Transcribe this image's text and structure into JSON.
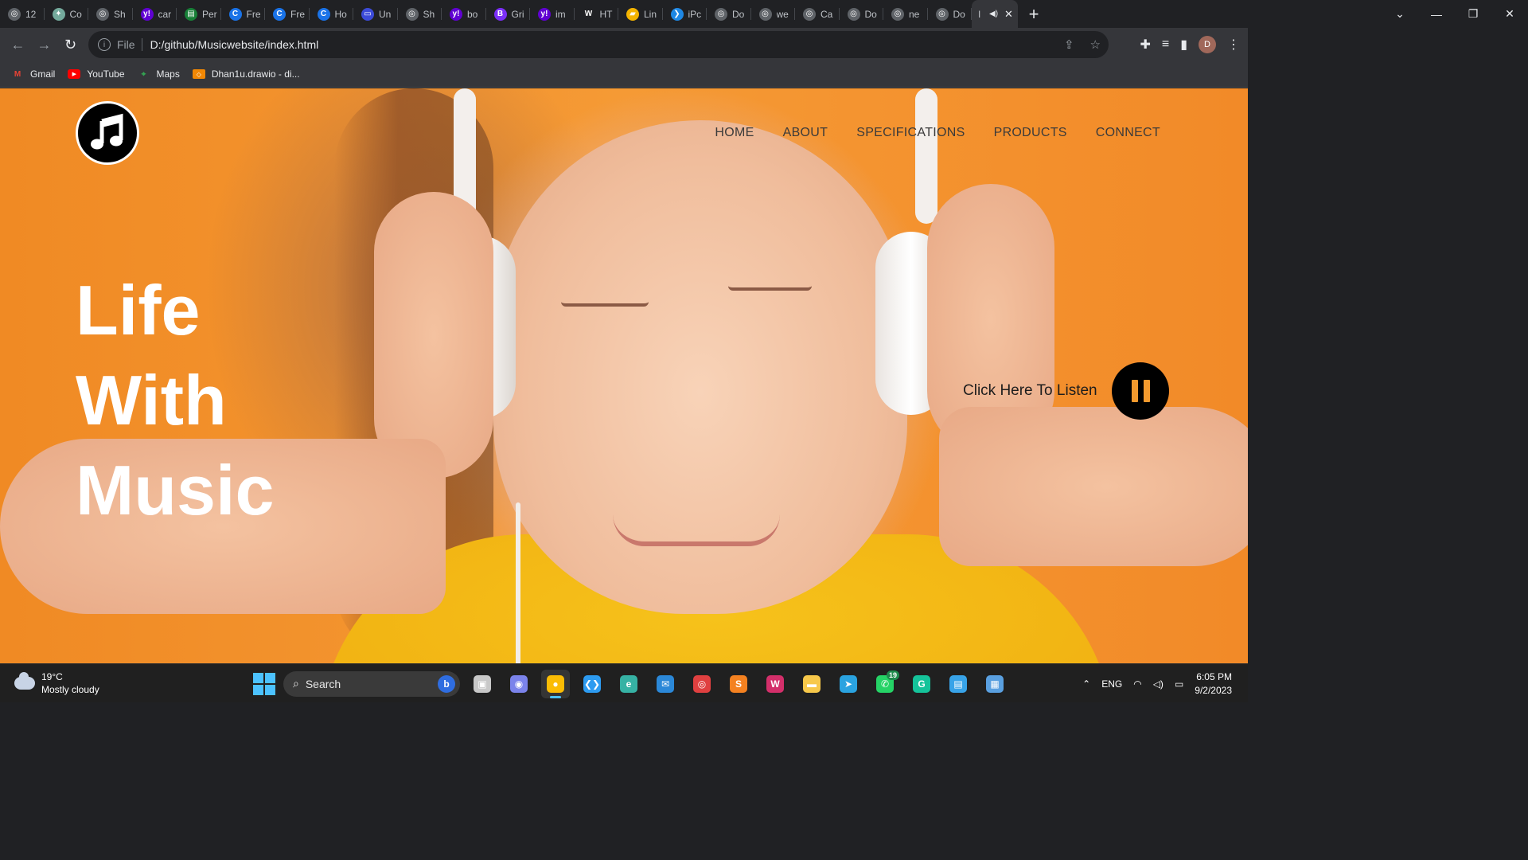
{
  "browser": {
    "tabs": [
      {
        "label": "12",
        "fav_color": "#5f6368",
        "fav_glyph": "◎"
      },
      {
        "label": "Co",
        "fav_color": "#74aa9c",
        "fav_glyph": "✦"
      },
      {
        "label": "Sh",
        "fav_color": "#5f6368",
        "fav_glyph": "◎"
      },
      {
        "label": "car",
        "fav_color": "#6001d2",
        "fav_glyph": "y!"
      },
      {
        "label": "Per",
        "fav_color": "#188038",
        "fav_glyph": "▤"
      },
      {
        "label": "Fre",
        "fav_color": "#1a73e8",
        "fav_glyph": "C"
      },
      {
        "label": "Fre",
        "fav_color": "#1a73e8",
        "fav_glyph": "C"
      },
      {
        "label": "Ho",
        "fav_color": "#1a73e8",
        "fav_glyph": "C"
      },
      {
        "label": "Un",
        "fav_color": "#3c4bd8",
        "fav_glyph": "▭"
      },
      {
        "label": "Sh",
        "fav_color": "#5f6368",
        "fav_glyph": "◎"
      },
      {
        "label": "bo",
        "fav_color": "#6001d2",
        "fav_glyph": "y!"
      },
      {
        "label": "Gri",
        "fav_color": "#7b2ff7",
        "fav_glyph": "B"
      },
      {
        "label": "im",
        "fav_color": "#6001d2",
        "fav_glyph": "y!"
      },
      {
        "label": "HT",
        "fav_color": "#202124",
        "fav_glyph": "W"
      },
      {
        "label": "Lin",
        "fav_color": "#f4b400",
        "fav_glyph": "▰"
      },
      {
        "label": "iPc",
        "fav_color": "#1e88e5",
        "fav_glyph": "❯"
      },
      {
        "label": "Do",
        "fav_color": "#5f6368",
        "fav_glyph": "◎"
      },
      {
        "label": "we",
        "fav_color": "#5f6368",
        "fav_glyph": "◎"
      },
      {
        "label": "Ca",
        "fav_color": "#5f6368",
        "fav_glyph": "◎"
      },
      {
        "label": "Do",
        "fav_color": "#5f6368",
        "fav_glyph": "◎"
      },
      {
        "label": "ne",
        "fav_color": "#5f6368",
        "fav_glyph": "◎"
      },
      {
        "label": "Do",
        "fav_color": "#5f6368",
        "fav_glyph": "◎"
      }
    ],
    "active_tab": {
      "label": "I"
    },
    "address": {
      "scheme": "File",
      "url": "D:/github/Musicwebsite/index.html"
    },
    "profile_initial": "D",
    "bookmarks": [
      {
        "label": "Gmail",
        "icon": "gmail-icon"
      },
      {
        "label": "YouTube",
        "icon": "youtube-icon"
      },
      {
        "label": "Maps",
        "icon": "maps-icon"
      },
      {
        "label": "Dhan1u.drawio - di...",
        "icon": "drawio-icon"
      }
    ]
  },
  "site": {
    "logo_icon": "music-note-icon",
    "nav": [
      "HOME",
      "ABOUT",
      "SPECIFICATIONS",
      "PRODUCTS",
      "CONNECT"
    ],
    "hero": {
      "line1": "Life",
      "line2": "With",
      "line3": "Music"
    },
    "listen_label": "Click Here To Listen",
    "play_state": "pause-icon",
    "colors": {
      "background": "#f28a28",
      "accent": "#f39a2e",
      "nav_text": "#3a3a3a"
    }
  },
  "taskbar": {
    "weather": {
      "temp": "19°C",
      "desc": "Mostly cloudy"
    },
    "search_label": "Search",
    "apps": [
      {
        "name": "task-view-app",
        "glyph": "▣",
        "color": "#c8c8c8",
        "active": false
      },
      {
        "name": "teams-app",
        "glyph": "◉",
        "color": "#7b83eb",
        "active": false
      },
      {
        "name": "chrome-app",
        "glyph": "●",
        "color": "#fbbc04",
        "active": true
      },
      {
        "name": "vscode-app",
        "glyph": "❮❯",
        "color": "#2d9bf0",
        "active": false
      },
      {
        "name": "edge-app",
        "glyph": "e",
        "color": "#36b2a4",
        "active": false
      },
      {
        "name": "mail-app",
        "glyph": "✉",
        "color": "#2b88d8",
        "active": false
      },
      {
        "name": "record-app",
        "glyph": "◎",
        "color": "#e04040",
        "active": false
      },
      {
        "name": "sublime-app",
        "glyph": "S",
        "color": "#f48120",
        "active": false
      },
      {
        "name": "wps-app",
        "glyph": "W",
        "color": "#d32f6a",
        "active": false
      },
      {
        "name": "file-explorer-app",
        "glyph": "▬",
        "color": "#f7c84a",
        "active": false
      },
      {
        "name": "telegram-app",
        "glyph": "➤",
        "color": "#2aa3e0",
        "active": false
      },
      {
        "name": "whatsapp-app",
        "glyph": "✆",
        "color": "#25d366",
        "active": false
      },
      {
        "name": "grammarly-app",
        "glyph": "G",
        "color": "#15c39a",
        "active": false
      },
      {
        "name": "notepad-app",
        "glyph": "▤",
        "color": "#38a3e8",
        "active": false
      },
      {
        "name": "paint-app",
        "glyph": "▦",
        "color": "#5aa0e0",
        "active": false
      }
    ],
    "whatsapp_badge": "19",
    "tray": {
      "lang": "ENG",
      "time": "6:05 PM",
      "date": "9/2/2023"
    }
  }
}
